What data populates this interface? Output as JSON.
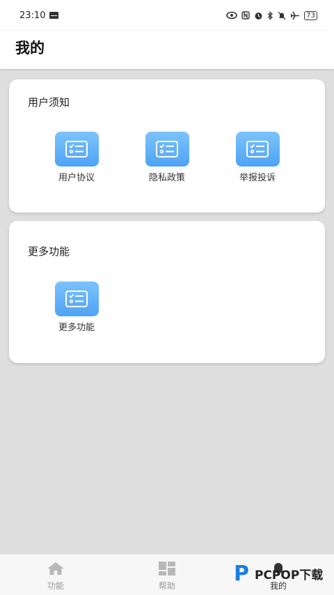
{
  "status_bar": {
    "time": "23:10",
    "battery": "73"
  },
  "header": {
    "title": "我的"
  },
  "cards": [
    {
      "title": "用户须知",
      "items": [
        {
          "label": "用户协议"
        },
        {
          "label": "隐私政策"
        },
        {
          "label": "举报投诉"
        }
      ]
    },
    {
      "title": "更多功能",
      "items": [
        {
          "label": "更多功能"
        }
      ]
    }
  ],
  "bottom_nav": [
    {
      "label": "功能",
      "icon": "home-icon"
    },
    {
      "label": "帮助",
      "icon": "grid-icon"
    },
    {
      "label": "我的",
      "icon": "bell-icon"
    }
  ],
  "watermark": {
    "text": "PCPOP下载"
  },
  "colors": {
    "accent": "#4ea3f6",
    "tile_top": "#7cc3fb",
    "background": "#dedede"
  }
}
